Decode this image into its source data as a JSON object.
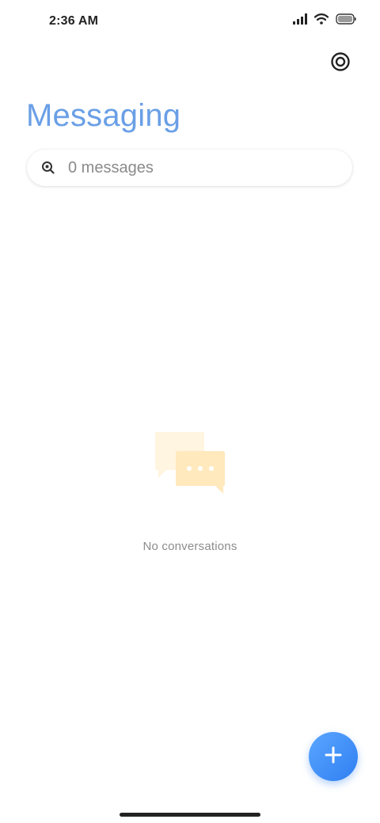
{
  "status_bar": {
    "time": "2:36 AM",
    "icons": [
      "signal-icon",
      "wifi-icon",
      "battery-icon"
    ]
  },
  "header": {
    "settings_icon": "settings-icon",
    "title": "Messaging"
  },
  "search": {
    "placeholder": "0 messages",
    "value": "",
    "icon": "search-icon"
  },
  "empty_state": {
    "icon": "chat-bubbles-icon",
    "text": "No conversations"
  },
  "fab": {
    "icon": "plus-icon"
  },
  "colors": {
    "title": "#6a9fe6",
    "fab": "#3f8ff5",
    "illustration_light": "#fff4dc",
    "illustration_dark": "#ffe8b8"
  }
}
